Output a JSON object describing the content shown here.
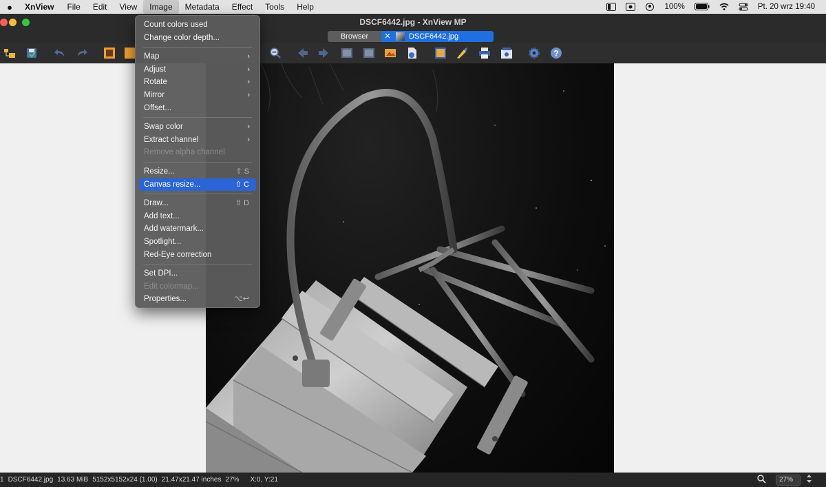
{
  "menubar": {
    "app_name": "XnView",
    "items": [
      "File",
      "Edit",
      "View",
      "Image",
      "Metadata",
      "Effect",
      "Tools",
      "Help"
    ],
    "battery": "100%",
    "date_time": "Pt. 20 wrz  19:40"
  },
  "window": {
    "title": "DSCF6442.jpg - XnView MP"
  },
  "tabs": {
    "browser_label": "Browser",
    "close_glyph": "✕",
    "active_label": "DSCF6442.jpg"
  },
  "image_menu": {
    "items": [
      {
        "label": "Count colors used"
      },
      {
        "label": "Change color depth..."
      },
      {
        "sep": true
      },
      {
        "label": "Map",
        "submenu": true
      },
      {
        "label": "Adjust",
        "submenu": true
      },
      {
        "label": "Rotate",
        "submenu": true
      },
      {
        "label": "Mirror",
        "submenu": true
      },
      {
        "label": "Offset..."
      },
      {
        "sep": true
      },
      {
        "label": "Swap color",
        "submenu": true
      },
      {
        "label": "Extract channel",
        "submenu": true
      },
      {
        "label": "Remove alpha channel",
        "disabled": true
      },
      {
        "sep": true
      },
      {
        "label": "Resize...",
        "shortcut": "⇧ S"
      },
      {
        "label": "Canvas resize...",
        "shortcut": "⇧ C",
        "highlight": true
      },
      {
        "sep": true
      },
      {
        "label": "Draw...",
        "shortcut": "⇧ D"
      },
      {
        "label": "Add text..."
      },
      {
        "label": "Add watermark..."
      },
      {
        "label": "Spotlight..."
      },
      {
        "label": "Red-Eye correction"
      },
      {
        "sep": true
      },
      {
        "label": "Set DPI..."
      },
      {
        "label": "Edit colormap...",
        "disabled": true
      },
      {
        "label": "Properties...",
        "shortcut": "⌥↩"
      }
    ]
  },
  "status": {
    "index": "1",
    "filename": "DSCF6442.jpg",
    "filesize": "13.63 MiB",
    "dimensions": "5152x5152x24 (1.00)",
    "print_size": "21.47x21.47 inches",
    "zoom": "27%",
    "coords": "X:0, Y:21",
    "zoom_box": "27%"
  },
  "colors": {
    "accent": "#2a64d6",
    "tab_active": "#1f6fe0",
    "toolbar_bg": "#2e2e2e",
    "viewer_bg": "#f0f0f0"
  },
  "icons": [
    "apple-icon",
    "open-folder-icon",
    "save-icon",
    "undo-icon",
    "redo-icon",
    "zoom-out-icon",
    "prev-icon",
    "next-icon",
    "settings-icon",
    "help-icon"
  ]
}
